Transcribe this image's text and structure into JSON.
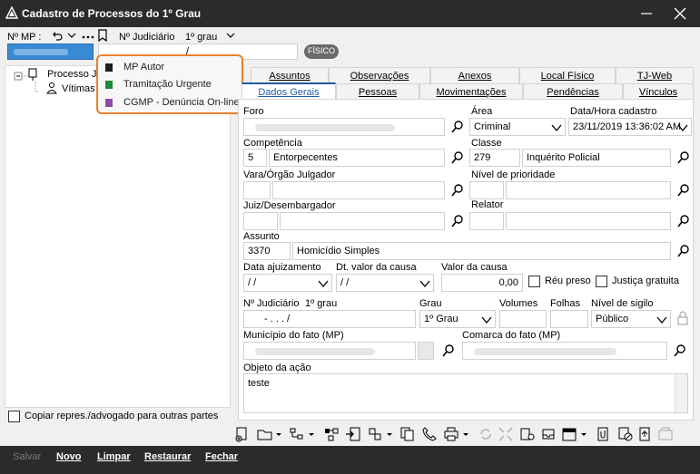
{
  "window": {
    "title": "Cadastro de Processos do 1º Grau"
  },
  "header": {
    "nmp_label": "Nº MP :",
    "njud_label": "Nº Judiciário",
    "grau_label": "1º grau",
    "njud_value": "/",
    "fisico_badge": "FÍSICO"
  },
  "tree": {
    "root": "Processo Ju",
    "child": "Vítimas"
  },
  "popup": {
    "items": [
      {
        "label": "MP Autor",
        "color": "#1e1e1e"
      },
      {
        "label": "Tramitação Urgente",
        "color": "#1f8a3a"
      },
      {
        "label": "CGMP - Denúncia On-line",
        "color": "#8e4ba6"
      }
    ]
  },
  "tabs": {
    "row1": [
      "Assuntos",
      "Observações",
      "Anexos",
      "Local Físico",
      "TJ-Web"
    ],
    "row2": [
      "Dados Gerais",
      "Pessoas",
      "Movimentações",
      "Pendências",
      "Vínculos"
    ]
  },
  "form": {
    "foro_label": "Foro",
    "area_label": "Área",
    "area_value": "Criminal",
    "datahora_label": "Data/Hora cadastro",
    "datahora_value": "23/11/2019 13:36:02 AM",
    "competencia_label": "Competência",
    "competencia_code": "5",
    "competencia_value": "Entorpecentes",
    "classe_label": "Classe",
    "classe_code": "279",
    "classe_value": "Inquérito Policial",
    "vara_label": "Vara/Órgão Julgador",
    "prioridade_label": "Nível de prioridade",
    "juiz_label": "Juiz/Desembargador",
    "relator_label": "Relator",
    "assunto_label": "Assunto",
    "assunto_code": "3370",
    "assunto_value": "Homicídio Simples",
    "dataaj_label": "Data ajuizamento",
    "dataaj_value": "/ /",
    "dtvalor_label": "Dt. valor da causa",
    "dtvalor_value": "/ /",
    "valor_label": "Valor da causa",
    "valor_value": "0,00",
    "reupreso_label": "Réu preso",
    "justica_label": "Justiça gratuita",
    "njud2_label": "Nº Judiciário",
    "njud2_grau": "1º grau",
    "njud2_value": "-  .  .  .  /",
    "grau_label": "Grau",
    "grau_value": "1º Grau",
    "volumes_label": "Volumes",
    "folhas_label": "Folhas",
    "sigilo_label": "Nível de sigilo",
    "sigilo_value": "Público",
    "municipio_label": "Município do fato (MP)",
    "comarca_label": "Comarca do fato (MP)",
    "objeto_label": "Objeto da ação",
    "objeto_value": "teste"
  },
  "left_footer": {
    "copiar_label": "Copiar repres./advogado para outras partes"
  },
  "bottom": {
    "salvar": "Salvar",
    "novo": "Novo",
    "limpar": "Limpar",
    "restaurar": "Restaurar",
    "fechar": "Fechar"
  },
  "colors": {
    "accent": "#1f5aa6",
    "popup_border": "#e8822b",
    "bar": "#2b2b2b"
  }
}
